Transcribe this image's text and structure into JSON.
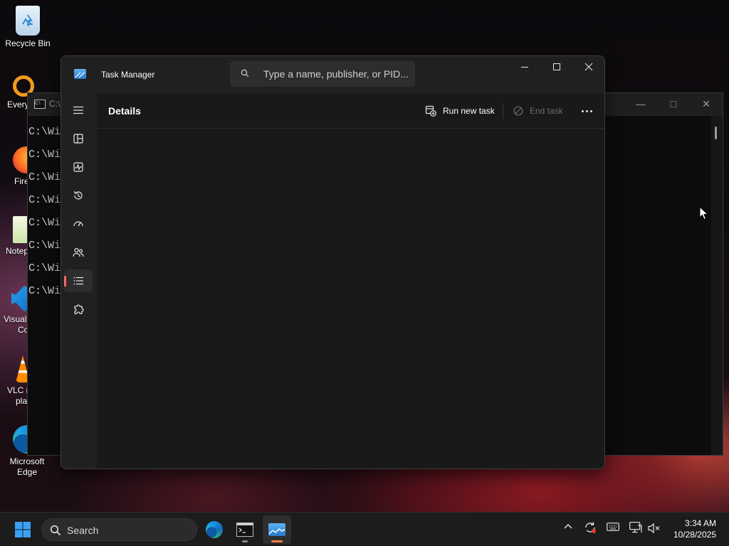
{
  "desktop": {
    "icons": [
      {
        "label": "Recycle Bin"
      },
      {
        "label": "Every"
      },
      {
        "label": "Fire"
      },
      {
        "label": "Notep"
      },
      {
        "label": "Visual",
        "label2": "Co"
      },
      {
        "label": "VLC n",
        "label2": "pla"
      },
      {
        "label": "Microsoft",
        "label2": "Edge"
      }
    ]
  },
  "console": {
    "title": "C:\\",
    "lines": [
      "C:\\Win",
      "C:\\Win",
      "C:\\Win",
      "C:\\Win",
      "C:\\Win",
      "C:\\Win",
      "C:\\Win",
      "C:\\Win"
    ]
  },
  "task_manager": {
    "title": "Task Manager",
    "search_placeholder": "Type a name, publisher, or PID...",
    "page_title": "Details",
    "run_new_task": "Run new task",
    "end_task": "End task",
    "nav": [
      "hamburger-icon",
      "processes-icon",
      "performance-icon",
      "app-history-icon",
      "startup-apps-icon",
      "users-icon",
      "details-icon",
      "services-icon",
      "settings-icon"
    ],
    "active_nav": "details",
    "accent": "#ff6a6a"
  },
  "taskbar": {
    "search_label": "Search",
    "time": "3:34 AM",
    "date": "10/28/2025",
    "active_accent": "#ff7a45"
  }
}
